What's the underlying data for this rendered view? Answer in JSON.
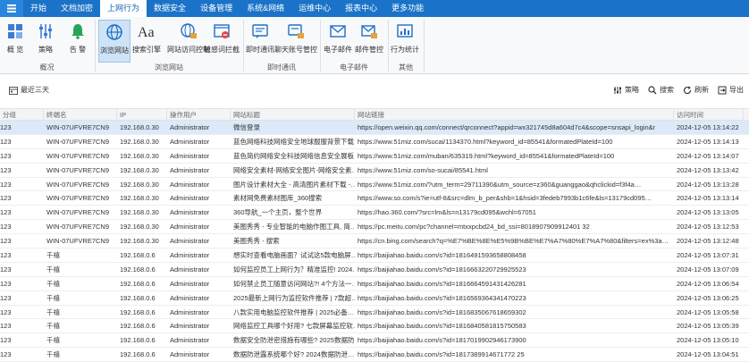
{
  "menu": {
    "app_icon": "app-menu-icon",
    "items": [
      {
        "label": "开始"
      },
      {
        "label": "文档加密"
      },
      {
        "label": "上网行为"
      },
      {
        "label": "数据安全"
      },
      {
        "label": "设备管理"
      },
      {
        "label": "系统&网络"
      },
      {
        "label": "运维中心"
      },
      {
        "label": "报表中心"
      },
      {
        "label": "更多功能"
      }
    ]
  },
  "ribbon": {
    "groups": [
      {
        "label": "概况"
      },
      {
        "label": "浏览网站"
      },
      {
        "label": "即时通讯"
      },
      {
        "label": "电子邮件"
      },
      {
        "label": "其他"
      }
    ],
    "buttons": [
      {
        "label": "概 览"
      },
      {
        "label": "策略"
      },
      {
        "label": "告 警"
      },
      {
        "label": "浏览网站"
      },
      {
        "label": "搜索引擎"
      },
      {
        "label": "网站访问控制"
      },
      {
        "label": "敏感词拦截"
      },
      {
        "label": "即时通讯"
      },
      {
        "label": "聊天账号管控"
      },
      {
        "label": "电子邮件"
      },
      {
        "label": "邮件管控"
      },
      {
        "label": "行为统计"
      }
    ]
  },
  "toolbar": {
    "range_label": "最近三天",
    "strategy": "策略",
    "search": "搜索",
    "refresh": "刷新",
    "export": "导出"
  },
  "accent": "#1a73c8",
  "table": {
    "headers": [
      "分组",
      "终端名",
      "IP",
      "操作用户",
      "网站标题",
      "网站链接",
      "访问时间"
    ],
    "rows": [
      [
        "123",
        "WIN-07UFVRE7CN9",
        "192.168.0.30",
        "Administrator",
        "微信登录",
        "https://open.weixin.qq.com/connect/qrconnect?appid=wx321745d8a604d7c4&scope=snsapi_login&r",
        "2024-12-05 13:14:22"
      ],
      [
        "123",
        "WIN-07UFVRE7CN9",
        "192.168.0.30",
        "Administrator",
        "蓝色网络科技网络安全地球服服背景下载…",
        "https://www.51miz.com/sucai/1134370.html?keyword_id=85541&formatedPlateId=100",
        "2024-12-05 13:14:13"
      ],
      [
        "123",
        "WIN-07UFVRE7CN9",
        "192.168.0.30",
        "Administrator",
        "蓝色简约网络安全科技网络信息安全展板…",
        "https://www.51miz.com/muban/635319.html?keyword_id=85541&formatedPlateId=100",
        "2024-12-05 13:14:07"
      ],
      [
        "123",
        "WIN-07UFVRE7CN9",
        "192.168.0.30",
        "Administrator",
        "网络安全素材-网络安全图片-网络安全素…",
        "https://www.51miz.com/so-sucai/85541.html",
        "2024-12-05 13:13:42"
      ],
      [
        "123",
        "WIN-07UFVRE7CN9",
        "192.168.0.30",
        "Administrator",
        "图片设计素材大全 - 高清图片素材下载 -…",
        "https://www.51miz.com/?utm_term=29711390&utm_source=z360&guanggao&qhclickid=f3f4a…",
        "2024-12-05 13:13:28"
      ],
      [
        "123",
        "WIN-07UFVRE7CN9",
        "192.168.0.30",
        "Administrator",
        "素材网免费素材图库_360搜索",
        "https://www.so.com/s?ie=utf-8&src=dlm_b_per&shb=1&hsid=3fedeb7993b1c6fe&ls=13179cd095…",
        "2024-12-05 13:13:14"
      ],
      [
        "123",
        "WIN-07UFVRE7CN9",
        "192.168.0.30",
        "Administrator",
        "360导航_一个主页，整个世界",
        "https://hao.360.com/?src=lm&ls=n13179cd095&wchl=67051",
        "2024-12-05 13:13:05"
      ],
      [
        "123",
        "WIN-07UFVRE7CN9",
        "192.168.0.30",
        "Administrator",
        "美图秀秀 - 专业智能的电脑作图工具, 简…",
        "https://pc.meitu.com/pc?channel=mtxxpcbd24_bd_ssi=8018907909912401 32",
        "2024-12-05 13:12:53"
      ],
      [
        "123",
        "WIN-07UFVRE7CN9",
        "192.168.0.30",
        "Administrator",
        "美图秀秀 - 搜索",
        "https://cn.bing.com/search?q=%E7%BE%8E%E5%9B%BE%E7%A7%80%E7%A7%80&filters=ex%3a…",
        "2024-12-05 13:12:48"
      ],
      [
        "123",
        "千禧",
        "192.168.0.6",
        "Administrator",
        "想实时查看电脑画面？试试这5款电脑屏…",
        "https://baijiahao.baidu.com/s?id=1816491593658808458",
        "2024-12-05 13:07:31"
      ],
      [
        "123",
        "千禧",
        "192.168.0.6",
        "Administrator",
        "如何监控员工上网行为？精准监控! 2024…",
        "https://baijiahao.baidu.com/s?id=1816663220729925523",
        "2024-12-05 13:07:09"
      ],
      [
        "123",
        "千禧",
        "192.168.0.6",
        "Administrator",
        "如何禁止员工随意访问网站?! 4个方法一…",
        "https://baijiahao.baidu.com/s?id=1816664591431426281",
        "2024-12-05 13:06:54"
      ],
      [
        "123",
        "千禧",
        "192.168.0.6",
        "Administrator",
        "2025最新上网行为监控软件推荐 | 7款超…",
        "https://baijiahao.baidu.com/s?id=1816569364341470223",
        "2024-12-05 13:06:25"
      ],
      [
        "123",
        "千禧",
        "192.168.0.6",
        "Administrator",
        "八款实用电脑监控软件推荐 | 2025必备…",
        "https://baijiahao.baidu.com/s?id=1816835067618659302",
        "2024-12-05 13:05:58"
      ],
      [
        "123",
        "千禧",
        "192.168.0.6",
        "Administrator",
        "网络监控工具哪个好用? 七款屏幕监控软…",
        "https://baijiahao.baidu.com/s?id=1816840581815750583",
        "2024-12-05 13:05:39"
      ],
      [
        "123",
        "千禧",
        "192.168.0.6",
        "Administrator",
        "数据安全防泄密措施有哪些? 2025数据防…",
        "https://baijiahao.baidu.com/s?id=1817019902946173900",
        "2024-12-05 13:05:10"
      ],
      [
        "123",
        "千禧",
        "192.168.0.6",
        "Administrator",
        "数据防泄露系统哪个好? 2024数据防泄…",
        "https://baijiahao.baidu.com/s?id=1817389914671772 25",
        "2024-12-05 13:04:51"
      ]
    ]
  }
}
